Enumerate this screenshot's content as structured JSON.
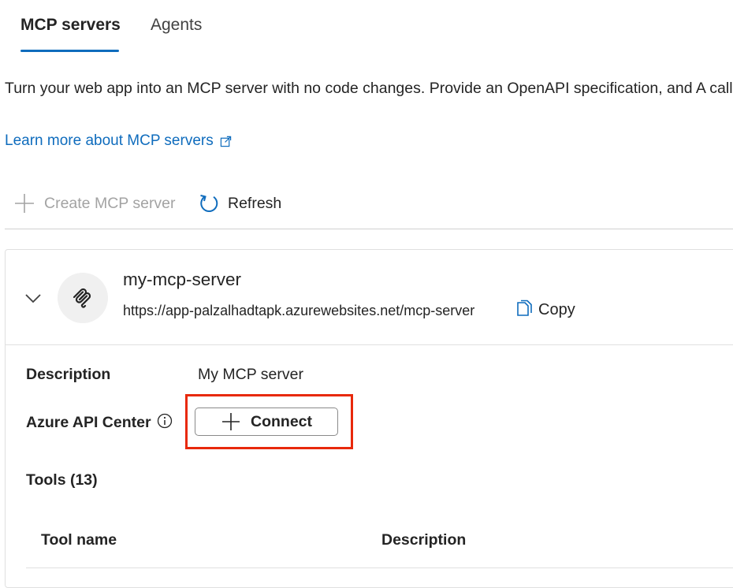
{
  "tabs": [
    {
      "label": "MCP servers",
      "active": true
    },
    {
      "label": "Agents",
      "active": false
    }
  ],
  "intro": {
    "description": "Turn your web app into an MCP server with no code changes. Provide an OpenAPI specification, and A call.",
    "learn_more_label": "Learn more about MCP servers",
    "learn_more_icon": "external-link-icon"
  },
  "toolbar": {
    "create_label": "Create MCP server",
    "create_icon": "plus-icon",
    "create_disabled": true,
    "refresh_label": "Refresh",
    "refresh_icon": "refresh-icon"
  },
  "server": {
    "name": "my-mcp-server",
    "url": "https://app-palzalhadtapk.azurewebsites.net/mcp-server",
    "copy_label": "Copy",
    "icon": "mcp-server-icon",
    "details": {
      "description_label": "Description",
      "description_value": "My MCP server",
      "api_center_label": "Azure API Center",
      "connect_label": "Connect",
      "tools_label": "Tools (13)"
    },
    "table": {
      "columns": [
        "Tool name",
        "Description"
      ]
    }
  },
  "colors": {
    "accent": "#0f6cbd",
    "highlight": "#e8290b",
    "disabled": "#a3a3a3"
  }
}
